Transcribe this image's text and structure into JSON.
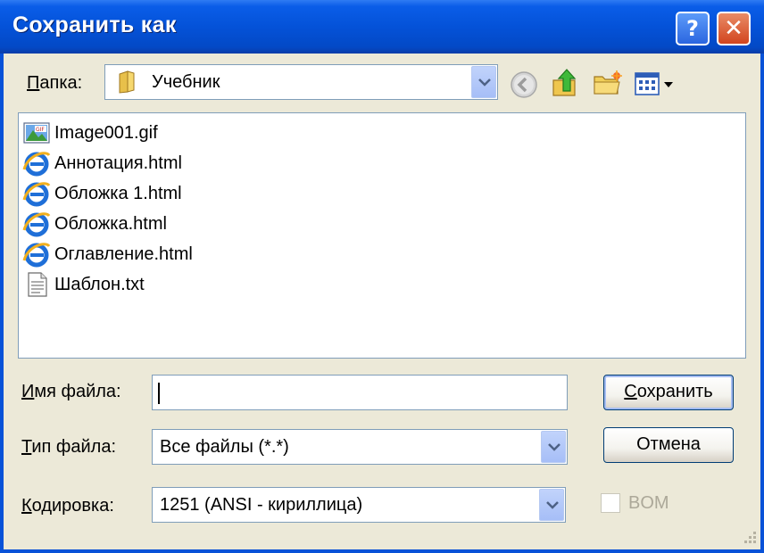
{
  "window": {
    "title": "Сохранить как",
    "help_glyph": "?",
    "close_glyph": "✕"
  },
  "folder": {
    "label_hotkey": "П",
    "label_rest": "апка:",
    "value": "Учебник",
    "icon": "folder-icon"
  },
  "toolbar": {
    "back_icon": "back-arrow-icon",
    "up_icon": "up-folder-icon",
    "new_folder_icon": "new-folder-icon",
    "views_icon": "views-menu-icon"
  },
  "files": [
    {
      "name": "Image001.gif",
      "icon": "gif-image-icon"
    },
    {
      "name": "Аннотация.html",
      "icon": "ie-html-icon"
    },
    {
      "name": "Обложка 1.html",
      "icon": "ie-html-icon"
    },
    {
      "name": "Обложка.html",
      "icon": "ie-html-icon"
    },
    {
      "name": "Оглавление.html",
      "icon": "ie-html-icon"
    },
    {
      "name": "Шаблон.txt",
      "icon": "text-file-icon"
    }
  ],
  "filename": {
    "label_hotkey": "И",
    "label_rest": "мя файла:",
    "value": ""
  },
  "filetype": {
    "label_hotkey": "Т",
    "label_rest": "ип файла:",
    "value": "Все файлы (*.*)"
  },
  "encoding": {
    "label_hotkey": "К",
    "label_rest": "одировка:",
    "value": "1251  (ANSI - кириллица)"
  },
  "buttons": {
    "save_hotkey": "С",
    "save_rest": "охранить",
    "cancel": "Отмена"
  },
  "bom": {
    "label": "BOM",
    "checked": false,
    "enabled": false
  },
  "colors": {
    "titlebar": "#0452D8",
    "dialog_bg": "#ECE9D8",
    "field_border": "#7F9DB9",
    "close_button": "#D2451E"
  }
}
